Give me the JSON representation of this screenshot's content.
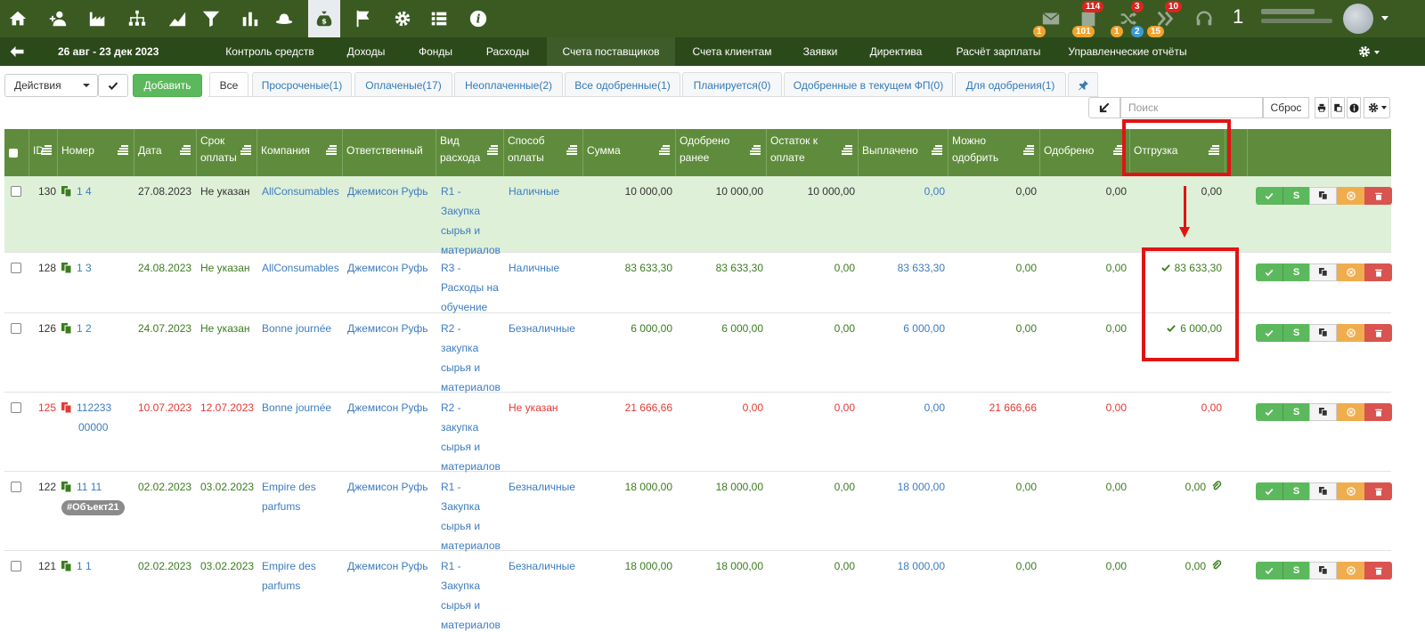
{
  "topbar": {
    "icons": [
      "home-icon",
      "user-plus-icon",
      "factory-icon",
      "org-chart-icon",
      "area-chart-icon",
      "filter-icon",
      "bar-chart-icon",
      "hat-icon",
      "money-bag-icon",
      "flag-icon",
      "gear-icon",
      "list-icon",
      "info-icon"
    ],
    "active_icon": "money-bag-icon",
    "notifications": {
      "mail_orange": "1",
      "docs_red": "114",
      "docs_orange": "101",
      "shuffle_red": "3",
      "shuffle_orange": "1",
      "shuffle_blue": "2",
      "shuffle_orange2": "15",
      "chevrons_red": "10"
    },
    "counter": "1"
  },
  "navbar": {
    "date_range": "26 авг - 23 дек 2023",
    "items": [
      "Контроль средств",
      "Доходы",
      "Фонды",
      "Расходы",
      "Счета поставщиков",
      "Счета клиентам",
      "Заявки",
      "Директива",
      "Расчёт зарплаты",
      "Управленческие отчёты"
    ],
    "active": "Счета поставщиков"
  },
  "toolbar": {
    "actions_label": "Действия",
    "add_label": "Добавить",
    "tabs": [
      "Все",
      "Просроченые(1)",
      "Оплаченые(17)",
      "Неоплаченные(2)",
      "Все одобренные(1)",
      "Планируется(0)",
      "Одобренные в текущем ФП(0)",
      "Для одобрения(1)"
    ],
    "search_placeholder": "Поиск",
    "reset_label": "Сброс"
  },
  "table": {
    "headers": [
      "ID",
      "Номер",
      "Дата",
      "Срок оплаты",
      "Компания",
      "Ответственный",
      "Вид расхода",
      "Способ оплаты",
      "Сумма",
      "Одобрено ранее",
      "Остаток к оплате",
      "Выплачено",
      "Можно одобрить",
      "Одобрено",
      "Отгрузка"
    ],
    "rows": [
      {
        "id": "130",
        "number": "1 4",
        "date": "27.08.2023",
        "due": "Не указан",
        "company": "AllConsumables",
        "responsible": "Джемисон Руфь",
        "expense": [
          "R1 -",
          "Закупка",
          "сырья и",
          "материалов"
        ],
        "payment": "Наличные",
        "sum": "10 000,00",
        "approved_before": "10 000,00",
        "remaining": "10 000,00",
        "paid": "0,00",
        "can_approve": "0,00",
        "approved": "0,00",
        "shipment": "0,00"
      },
      {
        "id": "128",
        "number": "1 3",
        "date": "24.08.2023",
        "due": "Не указан",
        "company": "AllConsumables",
        "responsible": "Джемисон Руфь",
        "expense": [
          "R3 -",
          "Расходы на",
          "обучение"
        ],
        "payment": "Наличные",
        "sum": "83 633,30",
        "approved_before": "83 633,30",
        "remaining": "0,00",
        "paid": "83 633,30",
        "can_approve": "0,00",
        "approved": "0,00",
        "shipment": "83 633,30"
      },
      {
        "id": "126",
        "number": "1 2",
        "date": "24.07.2023",
        "due": "Не указан",
        "company": "Bonne journée",
        "responsible": "Джемисон Руфь",
        "expense": [
          "R2 -",
          "закупка",
          "сырья и",
          "материалов"
        ],
        "payment": "Безналичные",
        "sum": "6 000,00",
        "approved_before": "6 000,00",
        "remaining": "0,00",
        "paid": "6 000,00",
        "can_approve": "0,00",
        "approved": "0,00",
        "shipment": "6 000,00"
      },
      {
        "id": "125",
        "number": [
          "112233",
          "00000"
        ],
        "date": "10.07.2023",
        "due": "12.07.2023",
        "company": "Bonne journée",
        "responsible": "Джемисон Руфь",
        "expense": [
          "R2 -",
          "закупка",
          "сырья и",
          "материалов"
        ],
        "payment": "Не указан",
        "sum": "21 666,66",
        "approved_before": "0,00",
        "remaining": "0,00",
        "paid": "0,00",
        "can_approve": "21 666,66",
        "approved": "0,00",
        "shipment": "0,00"
      },
      {
        "id": "122",
        "number": "11 11",
        "tag": "#Объект21",
        "date": "02.02.2023",
        "due": "03.02.2023",
        "company": [
          "Empire des",
          "parfums"
        ],
        "responsible": "Джемисон Руфь",
        "expense": [
          "R1 -",
          "Закупка",
          "сырья и",
          "материалов"
        ],
        "payment": "Безналичные",
        "sum": "18 000,00",
        "approved_before": "18 000,00",
        "remaining": "0,00",
        "paid": "18 000,00",
        "can_approve": "0,00",
        "approved": "0,00",
        "shipment": "0,00"
      },
      {
        "id": "121",
        "number": "1 1",
        "date": "02.02.2023",
        "due": "03.02.2023",
        "company": [
          "Empire des",
          "parfums"
        ],
        "responsible": "Джемисон Руфь",
        "expense": [
          "R1 -",
          "Закупка",
          "сырья и",
          "материалов"
        ],
        "payment": "Безналичные",
        "sum": "18 000,00",
        "approved_before": "18 000,00",
        "remaining": "0,00",
        "paid": "18 000,00",
        "can_approve": "0,00",
        "approved": "0,00",
        "shipment": "0,00"
      }
    ],
    "row_button_s": "S"
  },
  "colors": {
    "topbar": "#3a5a22",
    "navbar": "#2b4a1a",
    "header": "#5f8c3c",
    "highlight": "#dff0d8",
    "annotation": "#e01414"
  }
}
